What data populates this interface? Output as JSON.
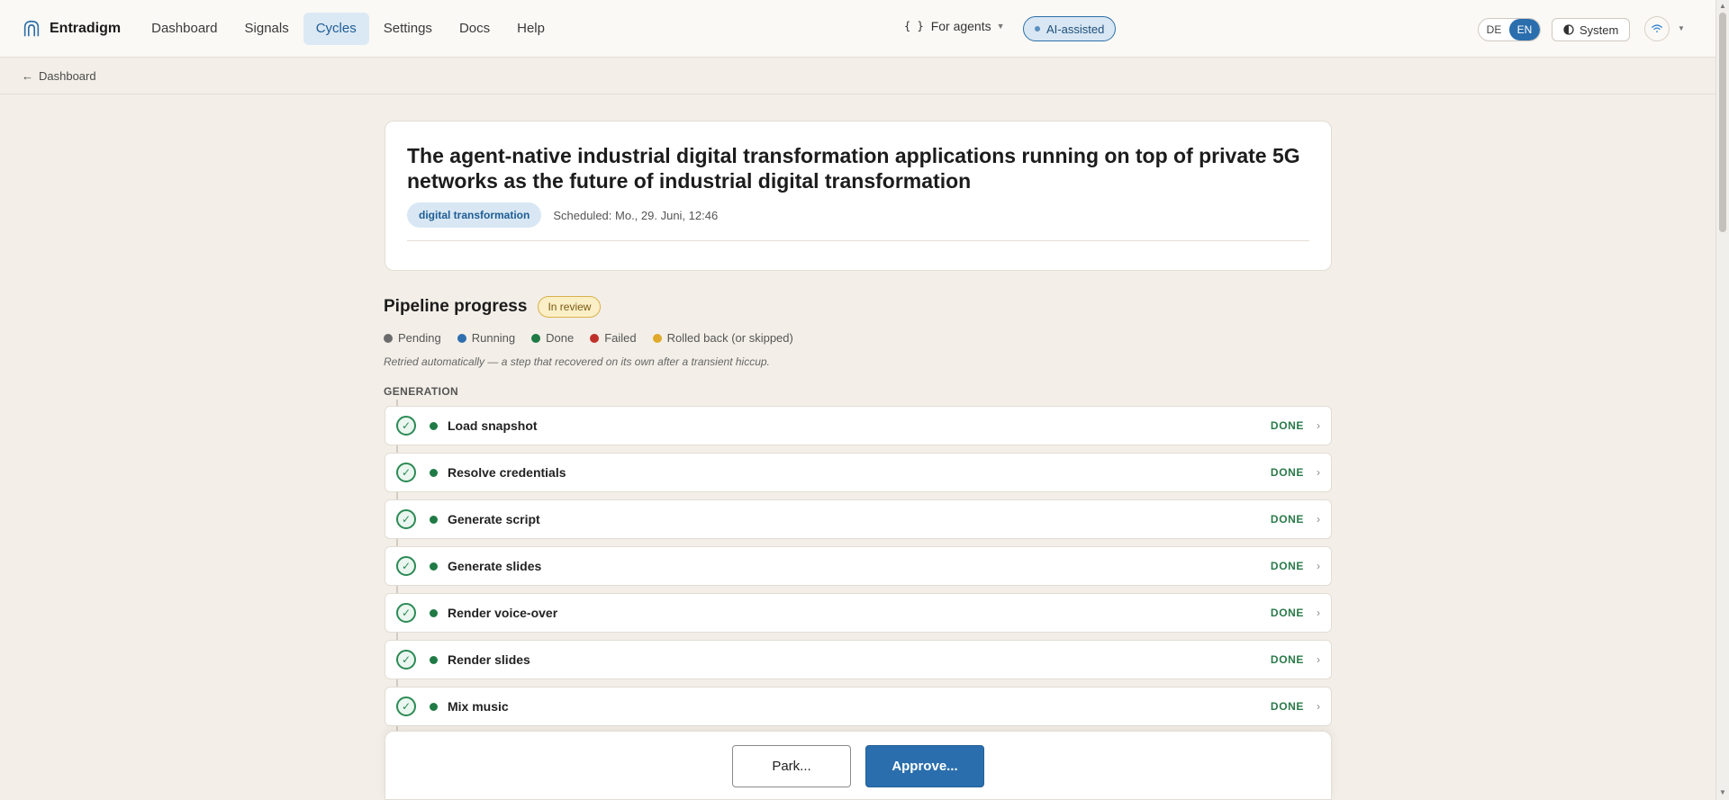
{
  "header": {
    "brand": "Entradigm",
    "nav": [
      {
        "label": "Dashboard",
        "active": false
      },
      {
        "label": "Signals",
        "active": false
      },
      {
        "label": "Cycles",
        "active": true
      },
      {
        "label": "Settings",
        "active": false
      },
      {
        "label": "Docs",
        "active": false
      },
      {
        "label": "Help",
        "active": false
      }
    ],
    "agents_braces": "{ }",
    "agents_label": "For agents",
    "ai_label": "AI-assisted",
    "lang_de": "DE",
    "lang_en": "EN",
    "theme_label": "System"
  },
  "breadcrumb": {
    "arrow": "←",
    "label": "Dashboard"
  },
  "cycle": {
    "title": "The agent-native industrial digital transformation applications running on top of private 5G networks as the future of industrial digital transformation",
    "topic": "digital transformation",
    "scheduled": "Scheduled: Mo., 29. Juni, 12:46"
  },
  "pipeline": {
    "title": "Pipeline progress",
    "status": "In review",
    "legend": [
      {
        "label": "Pending",
        "color": "#6b6b6b"
      },
      {
        "label": "Running",
        "color": "#2f6fb0"
      },
      {
        "label": "Done",
        "color": "#1f7a45"
      },
      {
        "label": "Failed",
        "color": "#c0302a"
      },
      {
        "label": "Rolled back (or skipped)",
        "color": "#e0a92a"
      }
    ],
    "retry_note": "Retried automatically — a step that recovered on its own after a transient hiccup.",
    "section": "GENERATION",
    "steps": [
      {
        "label": "Load snapshot",
        "status": "DONE"
      },
      {
        "label": "Resolve credentials",
        "status": "DONE"
      },
      {
        "label": "Generate script",
        "status": "DONE"
      },
      {
        "label": "Generate slides",
        "status": "DONE"
      },
      {
        "label": "Render voice-over",
        "status": "DONE"
      },
      {
        "label": "Render slides",
        "status": "DONE"
      },
      {
        "label": "Mix music",
        "status": "DONE"
      }
    ]
  },
  "actions": {
    "park": "Park...",
    "approve": "Approve..."
  },
  "colors": {
    "accent": "#2a6ead",
    "done": "#1f7a45",
    "review": "#d9b04a"
  }
}
